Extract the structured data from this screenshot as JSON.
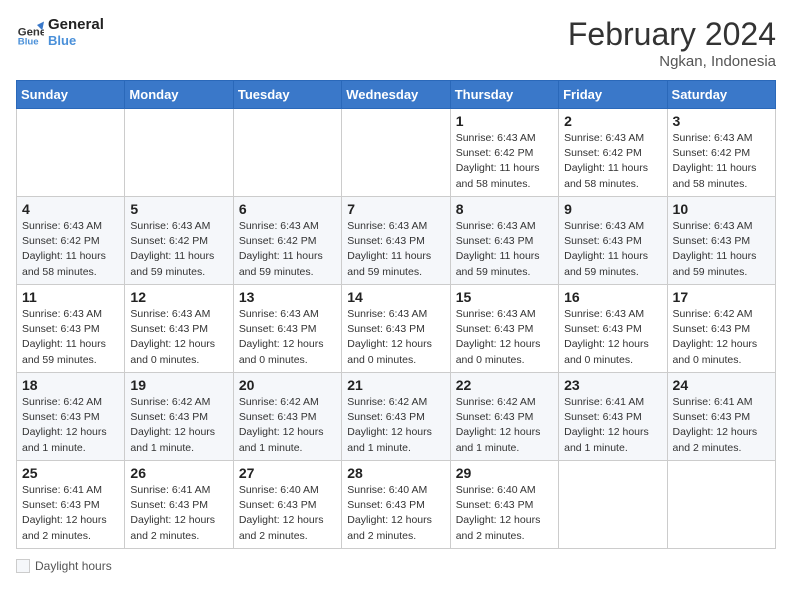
{
  "header": {
    "logo_line1": "General",
    "logo_line2": "Blue",
    "month_year": "February 2024",
    "location": "Ngkan, Indonesia"
  },
  "days_of_week": [
    "Sunday",
    "Monday",
    "Tuesday",
    "Wednesday",
    "Thursday",
    "Friday",
    "Saturday"
  ],
  "weeks": [
    [
      {
        "num": "",
        "info": ""
      },
      {
        "num": "",
        "info": ""
      },
      {
        "num": "",
        "info": ""
      },
      {
        "num": "",
        "info": ""
      },
      {
        "num": "1",
        "info": "Sunrise: 6:43 AM\nSunset: 6:42 PM\nDaylight: 11 hours\nand 58 minutes."
      },
      {
        "num": "2",
        "info": "Sunrise: 6:43 AM\nSunset: 6:42 PM\nDaylight: 11 hours\nand 58 minutes."
      },
      {
        "num": "3",
        "info": "Sunrise: 6:43 AM\nSunset: 6:42 PM\nDaylight: 11 hours\nand 58 minutes."
      }
    ],
    [
      {
        "num": "4",
        "info": "Sunrise: 6:43 AM\nSunset: 6:42 PM\nDaylight: 11 hours\nand 58 minutes."
      },
      {
        "num": "5",
        "info": "Sunrise: 6:43 AM\nSunset: 6:42 PM\nDaylight: 11 hours\nand 59 minutes."
      },
      {
        "num": "6",
        "info": "Sunrise: 6:43 AM\nSunset: 6:42 PM\nDaylight: 11 hours\nand 59 minutes."
      },
      {
        "num": "7",
        "info": "Sunrise: 6:43 AM\nSunset: 6:43 PM\nDaylight: 11 hours\nand 59 minutes."
      },
      {
        "num": "8",
        "info": "Sunrise: 6:43 AM\nSunset: 6:43 PM\nDaylight: 11 hours\nand 59 minutes."
      },
      {
        "num": "9",
        "info": "Sunrise: 6:43 AM\nSunset: 6:43 PM\nDaylight: 11 hours\nand 59 minutes."
      },
      {
        "num": "10",
        "info": "Sunrise: 6:43 AM\nSunset: 6:43 PM\nDaylight: 11 hours\nand 59 minutes."
      }
    ],
    [
      {
        "num": "11",
        "info": "Sunrise: 6:43 AM\nSunset: 6:43 PM\nDaylight: 11 hours\nand 59 minutes."
      },
      {
        "num": "12",
        "info": "Sunrise: 6:43 AM\nSunset: 6:43 PM\nDaylight: 12 hours\nand 0 minutes."
      },
      {
        "num": "13",
        "info": "Sunrise: 6:43 AM\nSunset: 6:43 PM\nDaylight: 12 hours\nand 0 minutes."
      },
      {
        "num": "14",
        "info": "Sunrise: 6:43 AM\nSunset: 6:43 PM\nDaylight: 12 hours\nand 0 minutes."
      },
      {
        "num": "15",
        "info": "Sunrise: 6:43 AM\nSunset: 6:43 PM\nDaylight: 12 hours\nand 0 minutes."
      },
      {
        "num": "16",
        "info": "Sunrise: 6:43 AM\nSunset: 6:43 PM\nDaylight: 12 hours\nand 0 minutes."
      },
      {
        "num": "17",
        "info": "Sunrise: 6:42 AM\nSunset: 6:43 PM\nDaylight: 12 hours\nand 0 minutes."
      }
    ],
    [
      {
        "num": "18",
        "info": "Sunrise: 6:42 AM\nSunset: 6:43 PM\nDaylight: 12 hours\nand 1 minute."
      },
      {
        "num": "19",
        "info": "Sunrise: 6:42 AM\nSunset: 6:43 PM\nDaylight: 12 hours\nand 1 minute."
      },
      {
        "num": "20",
        "info": "Sunrise: 6:42 AM\nSunset: 6:43 PM\nDaylight: 12 hours\nand 1 minute."
      },
      {
        "num": "21",
        "info": "Sunrise: 6:42 AM\nSunset: 6:43 PM\nDaylight: 12 hours\nand 1 minute."
      },
      {
        "num": "22",
        "info": "Sunrise: 6:42 AM\nSunset: 6:43 PM\nDaylight: 12 hours\nand 1 minute."
      },
      {
        "num": "23",
        "info": "Sunrise: 6:41 AM\nSunset: 6:43 PM\nDaylight: 12 hours\nand 1 minute."
      },
      {
        "num": "24",
        "info": "Sunrise: 6:41 AM\nSunset: 6:43 PM\nDaylight: 12 hours\nand 2 minutes."
      }
    ],
    [
      {
        "num": "25",
        "info": "Sunrise: 6:41 AM\nSunset: 6:43 PM\nDaylight: 12 hours\nand 2 minutes."
      },
      {
        "num": "26",
        "info": "Sunrise: 6:41 AM\nSunset: 6:43 PM\nDaylight: 12 hours\nand 2 minutes."
      },
      {
        "num": "27",
        "info": "Sunrise: 6:40 AM\nSunset: 6:43 PM\nDaylight: 12 hours\nand 2 minutes."
      },
      {
        "num": "28",
        "info": "Sunrise: 6:40 AM\nSunset: 6:43 PM\nDaylight: 12 hours\nand 2 minutes."
      },
      {
        "num": "29",
        "info": "Sunrise: 6:40 AM\nSunset: 6:43 PM\nDaylight: 12 hours\nand 2 minutes."
      },
      {
        "num": "",
        "info": ""
      },
      {
        "num": "",
        "info": ""
      }
    ]
  ],
  "footer": {
    "legend_label": "Daylight hours"
  }
}
